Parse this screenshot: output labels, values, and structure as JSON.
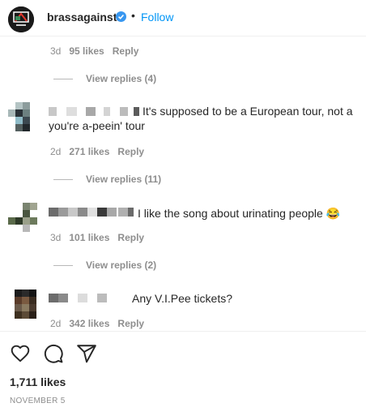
{
  "header": {
    "username": "brassagainst",
    "separator": "•",
    "follow_label": "Follow",
    "brand_color": "#0095f6"
  },
  "top_reply": {
    "age": "3d",
    "likes": "95 likes",
    "reply_label": "Reply",
    "view_replies": "View replies (4)"
  },
  "comments": [
    {
      "text": "It's supposed to be a European tour, not a you're a-peein' tour",
      "age": "2d",
      "likes": "271 likes",
      "reply_label": "Reply",
      "view_replies": "View replies (11)"
    },
    {
      "text": "I like the song about urinating people",
      "emoji": "😂",
      "age": "3d",
      "likes": "101 likes",
      "reply_label": "Reply",
      "view_replies": "View replies (2)"
    },
    {
      "text": "Any V.I.Pee tickets?",
      "age": "2d",
      "likes": "342 likes",
      "reply_label": "Reply"
    }
  ],
  "footer": {
    "likes_total": "1,711 likes",
    "date": "NOVEMBER 5",
    "icons": [
      "heart-icon",
      "comment-icon",
      "share-icon"
    ]
  }
}
